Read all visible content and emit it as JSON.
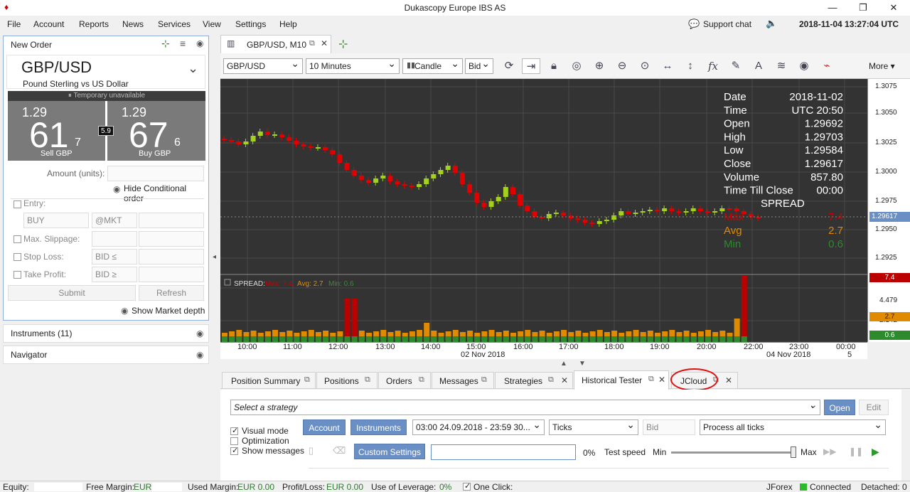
{
  "titlebar": {
    "title": "Dukascopy Europe IBS AS"
  },
  "menu": [
    "File",
    "Account",
    "Reports",
    "News",
    "Services",
    "View",
    "Settings",
    "Help"
  ],
  "topright": {
    "support": "Support chat",
    "datetime": "2018-11-04 13:27:04 UTC"
  },
  "order": {
    "header": "New Order",
    "pair": "GBP/USD",
    "pair_name": "Pound Sterling vs US Dollar",
    "status": "Temporary unavailable",
    "sell_big": "1.29",
    "sell_main": "61",
    "sell_frac": "7",
    "sell_label": "Sell GBP",
    "spread": "5.9",
    "buy_big": "1.29",
    "buy_main": "67",
    "buy_frac": "6",
    "buy_label": "Buy GBP",
    "amount_label": "Amount (units):",
    "hide_cond": "Hide Conditional order",
    "entry": "Entry:",
    "entry_side": "BUY",
    "entry_type": "@MKT",
    "slippage": "Max. Slippage:",
    "stoploss": "Stop Loss:",
    "sl_side": "BID ≤",
    "takeprofit": "Take Profit:",
    "tp_side": "BID ≥",
    "submit": "Submit",
    "refresh": "Refresh",
    "market_depth": "Show Market depth"
  },
  "instruments": "Instruments (11)",
  "navigator": "Navigator",
  "chart_tab": "GBP/USD, M10",
  "chart_toolbar": {
    "instrument": "GBP/USD",
    "period": "10 Minutes",
    "type": "Candle",
    "side": "Bid",
    "more": "More"
  },
  "chart_info": {
    "rows": [
      [
        "Date",
        "2018-11-02"
      ],
      [
        "Time",
        "UTC 20:50"
      ],
      [
        "Open",
        "1.29692"
      ],
      [
        "High",
        "1.29703"
      ],
      [
        "Low",
        "1.29584"
      ],
      [
        "Close",
        "1.29617"
      ],
      [
        "Volume",
        "857.80"
      ],
      [
        "Time Till Close",
        "00:00"
      ]
    ],
    "spread_title": "SPREAD",
    "spread_rows": [
      [
        "Max",
        "7.4"
      ],
      [
        "Avg",
        "2.7"
      ],
      [
        "Min",
        "0.6"
      ]
    ]
  },
  "price_axis": [
    "1.3075",
    "1.3050",
    "1.3025",
    "1.3000",
    "1.2975",
    "1.2950",
    "1.2925"
  ],
  "current_price": "1.29617",
  "spread_axis": [
    "6.816",
    "4.479",
    "2.142"
  ],
  "spread_markers": {
    "max": "7.4",
    "avg": "2.7",
    "min": "0.6"
  },
  "spread_legend": {
    "name": "SPREAD:",
    "max": "Max: 7.4,",
    "avg": "Avg: 2.7",
    "min": "Min: 0.6"
  },
  "time_axis": [
    "10:00",
    "11:00",
    "12:00",
    "13:00",
    "14:00",
    "15:00",
    "16:00",
    "17:00",
    "18:00",
    "19:00",
    "20:00",
    "22:00",
    "23:00",
    "00:00"
  ],
  "date_labels": {
    "d1": "02 Nov 2018",
    "d2": "04 Nov 2018",
    "d3": "5"
  },
  "bottom_tabs": [
    "Position Summary",
    "Positions",
    "Orders",
    "Messages",
    "Strategies",
    "Historical Tester",
    "JCloud"
  ],
  "tester": {
    "strategy_placeholder": "Select a strategy",
    "open": "Open",
    "edit": "Edit",
    "visual": "Visual mode",
    "optimization": "Optimization",
    "show_messages": "Show messages",
    "account": "Account",
    "instruments": "Instruments",
    "period": "03:00 24.09.2018 - 23:59 30...",
    "ticks": "Ticks",
    "bid": "Bid",
    "process": "Process all ticks",
    "custom": "Custom Settings",
    "percent": "0%",
    "test_speed": "Test speed",
    "min": "Min",
    "max": "Max"
  },
  "status": {
    "equity": "Equity:",
    "free_margin": "Free Margin:",
    "fm_val": "EUR",
    "used_margin": "Used Margin:",
    "um_val": "EUR 0.00",
    "pl": "Profit/Loss:",
    "pl_val": "EUR 0.00",
    "leverage": "Use of Leverage:",
    "lev_val": "0%",
    "one_click": "One Click:",
    "jforex": "JForex",
    "connected": "Connected",
    "detached": "Detached: 0"
  },
  "colors": {
    "up": "#a4d11c",
    "down": "#e00000",
    "accent": "#6a8fc4"
  }
}
